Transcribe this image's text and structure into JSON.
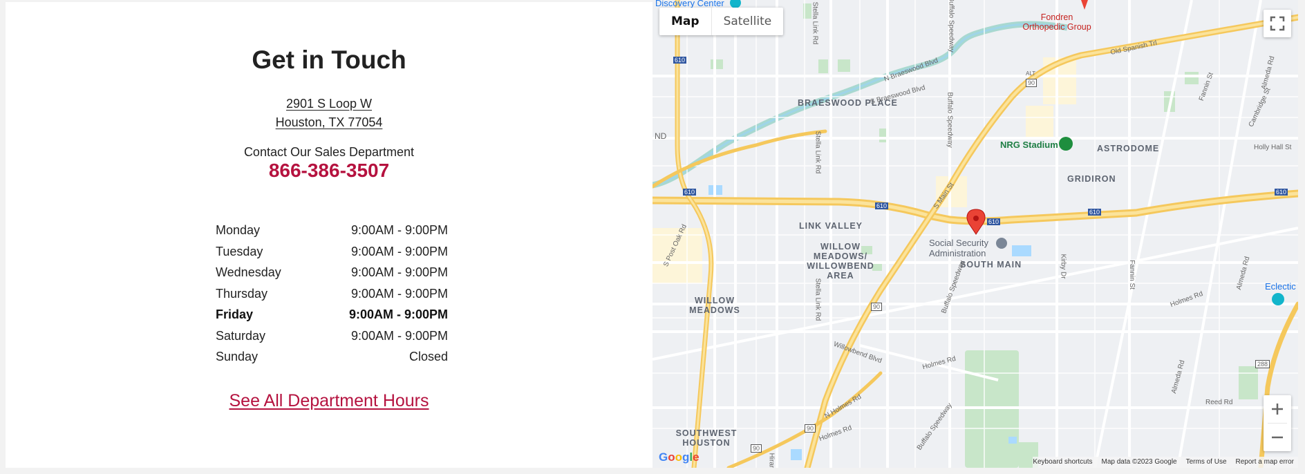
{
  "contact": {
    "title": "Get in Touch",
    "address_line1": "2901 S Loop W",
    "address_line2": "Houston, TX 77054",
    "department_label": "Contact Our Sales Department",
    "phone": "866-386-3507",
    "see_all_link": "See All Department Hours",
    "accent_color": "#b5123f",
    "hours": [
      {
        "day": "Monday",
        "time": "9:00AM - 9:00PM"
      },
      {
        "day": "Tuesday",
        "time": "9:00AM - 9:00PM"
      },
      {
        "day": "Wednesday",
        "time": "9:00AM - 9:00PM"
      },
      {
        "day": "Thursday",
        "time": "9:00AM - 9:00PM"
      },
      {
        "day": "Friday",
        "time": "9:00AM - 9:00PM"
      },
      {
        "day": "Saturday",
        "time": "9:00AM - 9:00PM"
      },
      {
        "day": "Sunday",
        "time": "Closed"
      }
    ]
  },
  "map": {
    "map_type_map": "Map",
    "map_type_satellite": "Satellite",
    "zoom_in": "+",
    "zoom_out": "−",
    "areas": {
      "braeswood_place": "BRAESWOOD PLACE",
      "astrodome": "ASTRODOME",
      "gridiron": "GRIDIRON",
      "link_valley": "LINK VALLEY",
      "willow_meadows_willowbend": "WILLOW MEADOWS/ WILLOWBEND AREA",
      "south_main": "SOUTH MAIN",
      "willow_meadows": "WILLOW MEADOWS",
      "southwest_houston": "SOUTHWEST HOUSTON"
    },
    "pois": {
      "discovery_center": "Discovery Center",
      "fondren": "Fondren Orthopedic Group",
      "nrg_stadium": "NRG Stadium",
      "social_security": "Social Security Administration",
      "eclectic": "Eclectic"
    },
    "roads": {
      "stella_link_1": "Stella Link Rd",
      "stella_link_2": "Stella Link Rd",
      "stella_link_3": "Stella Link Rd",
      "buffalo_1": "Buffalo Speedway",
      "buffalo_2": "Buffalo Speedway",
      "buffalo_3": "Buffalo Speedway",
      "buffalo_top": "Buffalo Speedway",
      "n_braeswood": "N Braeswood Blvd",
      "s_braeswood": "S Braeswood Blvd",
      "old_spanish": "Old Spanish Trl",
      "s_main": "S Main St",
      "s_post_oak": "S Post Oak Rd",
      "willowbend": "Willowbend Blvd",
      "holmes_1": "Holmes Rd",
      "holmes_2": "Holmes Rd",
      "holmes_3": "Holmes Rd",
      "n_holmes": "N Holmes Rd",
      "kirby": "Kirby Dr",
      "fannin_1": "Fannin St",
      "fannin_2": "Fannin St",
      "cambridge": "Cambridge St",
      "almeda_1": "Almeda Rd",
      "almeda_2": "Almeda Rd",
      "almeda_3": "Almeda Rd",
      "holly_hall": "Holly Hall St",
      "reed": "Reed Rd",
      "hiram": "Hiran",
      "shield_610_a": "610",
      "shield_610_b": "610",
      "shield_610_c": "610",
      "shield_610_d": "610",
      "shield_610_e": "610",
      "shield_610_f": "610",
      "shield_90_a": "90",
      "shield_90_b": "90",
      "shield_90_c": "90",
      "shield_90_d": "90",
      "shield_288": "288",
      "alt": "ALT",
      "edge_nd": "ND"
    },
    "attribution": {
      "keyboard": "Keyboard shortcuts",
      "data": "Map data ©2023 Google",
      "terms": "Terms of Use",
      "report": "Report a map error"
    },
    "logo_text": "Google"
  }
}
